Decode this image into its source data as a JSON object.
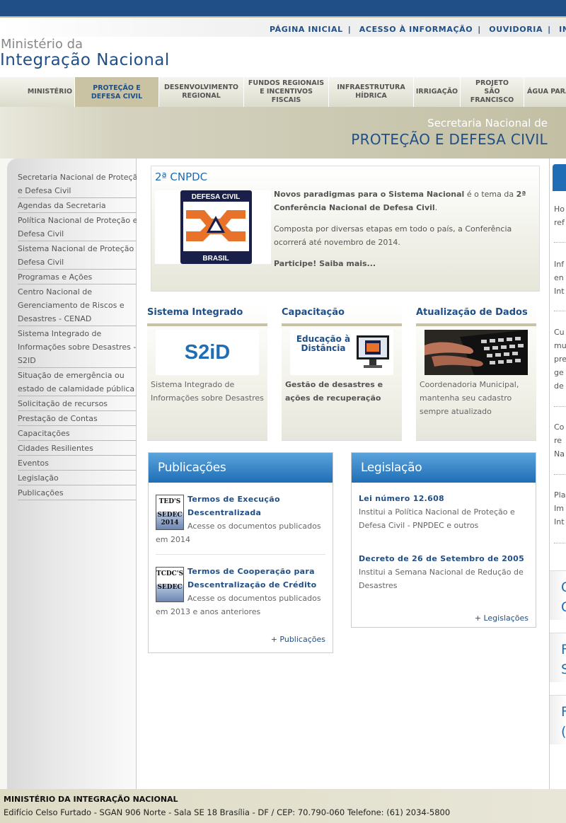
{
  "top_links": [
    "PÁGINA INICIAL",
    "ACESSO À INFORMAÇÃO",
    "OUVIDORIA",
    "INTE"
  ],
  "brand": {
    "line1": "Ministério da",
    "line2": "Integração Nacional"
  },
  "nav": [
    {
      "label": "MINISTÉRIO"
    },
    {
      "label": "PROTEÇÃO E DEFESA CIVIL",
      "active": true
    },
    {
      "label": "DESENVOLVIMENTO REGIONAL"
    },
    {
      "label": "FUNDOS REGIONAIS E INCENTIVOS FISCAIS"
    },
    {
      "label": "INFRAESTRUTURA HÍDRICA"
    },
    {
      "label": "IRRIGAÇÃO"
    },
    {
      "label": "PROJETO SÃO FRANCISCO"
    },
    {
      "label": "ÁGUA PARA"
    }
  ],
  "banner": {
    "line1": "Secretaria Nacional de",
    "line2": "PROTEÇÃO E DEFESA CIVIL"
  },
  "sidebar": [
    "Secretaria Nacional de Proteção e Defesa Civil",
    "Agendas da Secretaria",
    "Política Nacional de Proteção e Defesa Civil",
    "Sistema Nacional de Proteção e Defesa Civil",
    "Programas e Ações",
    "Centro Nacional de Gerenciamento de Riscos e Desastres - CENAD",
    "Sistema Integrado de Informações sobre Desastres - S2ID",
    "Situação de emergência ou estado de calamidade pública",
    "Solicitação de recursos",
    "Prestação de Contas",
    "Capacitações",
    "Cidades Resilientes",
    "Eventos",
    "Legislação",
    "Publicações"
  ],
  "feature": {
    "title": "2ª CNPDC",
    "logo_top": "DEFESA CIVIL",
    "logo_bottom": "BRASIL",
    "p1_bold": "Novos paradigmas para o Sistema Nacional",
    "p1_mid": " é o tema da ",
    "p1_bold2": "2ª Conferência Nacional de Defesa Civil",
    "p1_end": ".",
    "p2": "Composta por diversas etapas em todo o país, a Conferência ocorrerá até novembro de 2014.",
    "p3": "Participe! Saiba mais..."
  },
  "cards": [
    {
      "title": "Sistema Integrado",
      "image_text": "S2iD",
      "desc": "Sistema Integrado de Informações sobre Desastres"
    },
    {
      "title": "Capacitação",
      "image_text": "Educação à Distância",
      "desc": "Gestão de desastres e ações de recuperação"
    },
    {
      "title": "Atualização de Dados",
      "image_text": "",
      "desc": "Coordenadoria Municipal, mantenha seu cadastro sempre atualizado"
    }
  ],
  "publicacoes": {
    "header": "Publicações",
    "items": [
      {
        "thumb1": "TED'S",
        "thumb2": "SEDEC",
        "thumb3": "2014",
        "title": "Termos de Execução Descentralizada",
        "desc": "Acesse os documentos publicados em 2014"
      },
      {
        "thumb1": "TCDC'S",
        "thumb2": "SEDEC",
        "thumb3": "",
        "title": "Termos de Cooperação para Descentralização de Crédito",
        "desc": "Acesse os documentos publicados em 2013 e anos anteriores"
      }
    ],
    "more": "+ Publicações"
  },
  "legislacao": {
    "header": "Legislação",
    "items": [
      {
        "title": "Lei número 12.608",
        "desc": "Institui a Política Nacional de Proteção e Defesa Civil - PNPDEC e outros"
      },
      {
        "title": "Decreto de 26 de Setembro de 2005",
        "desc": "Institui a Semana Nacional de Redução de Desastres"
      }
    ],
    "more": "+ Legislações"
  },
  "right_fragments": [
    "Ho",
    "ref",
    "Inf",
    "en",
    "Int",
    "Cu",
    "mu",
    "pre",
    "ge",
    "de",
    "Co",
    "re",
    "Na",
    "Pla",
    "Im",
    "Int"
  ],
  "right_blocks": [
    "C",
    "C",
    "F",
    "S",
    "F",
    "("
  ],
  "footer": {
    "line1": "MINISTÉRIO DA INTEGRAÇÃO NACIONAL",
    "line2": "Edifício Celso Furtado - SGAN 906 Norte - Sala SE 18 Brasília - DF / CEP: 70.790-060 Telefone: (61) 2034-5800"
  }
}
